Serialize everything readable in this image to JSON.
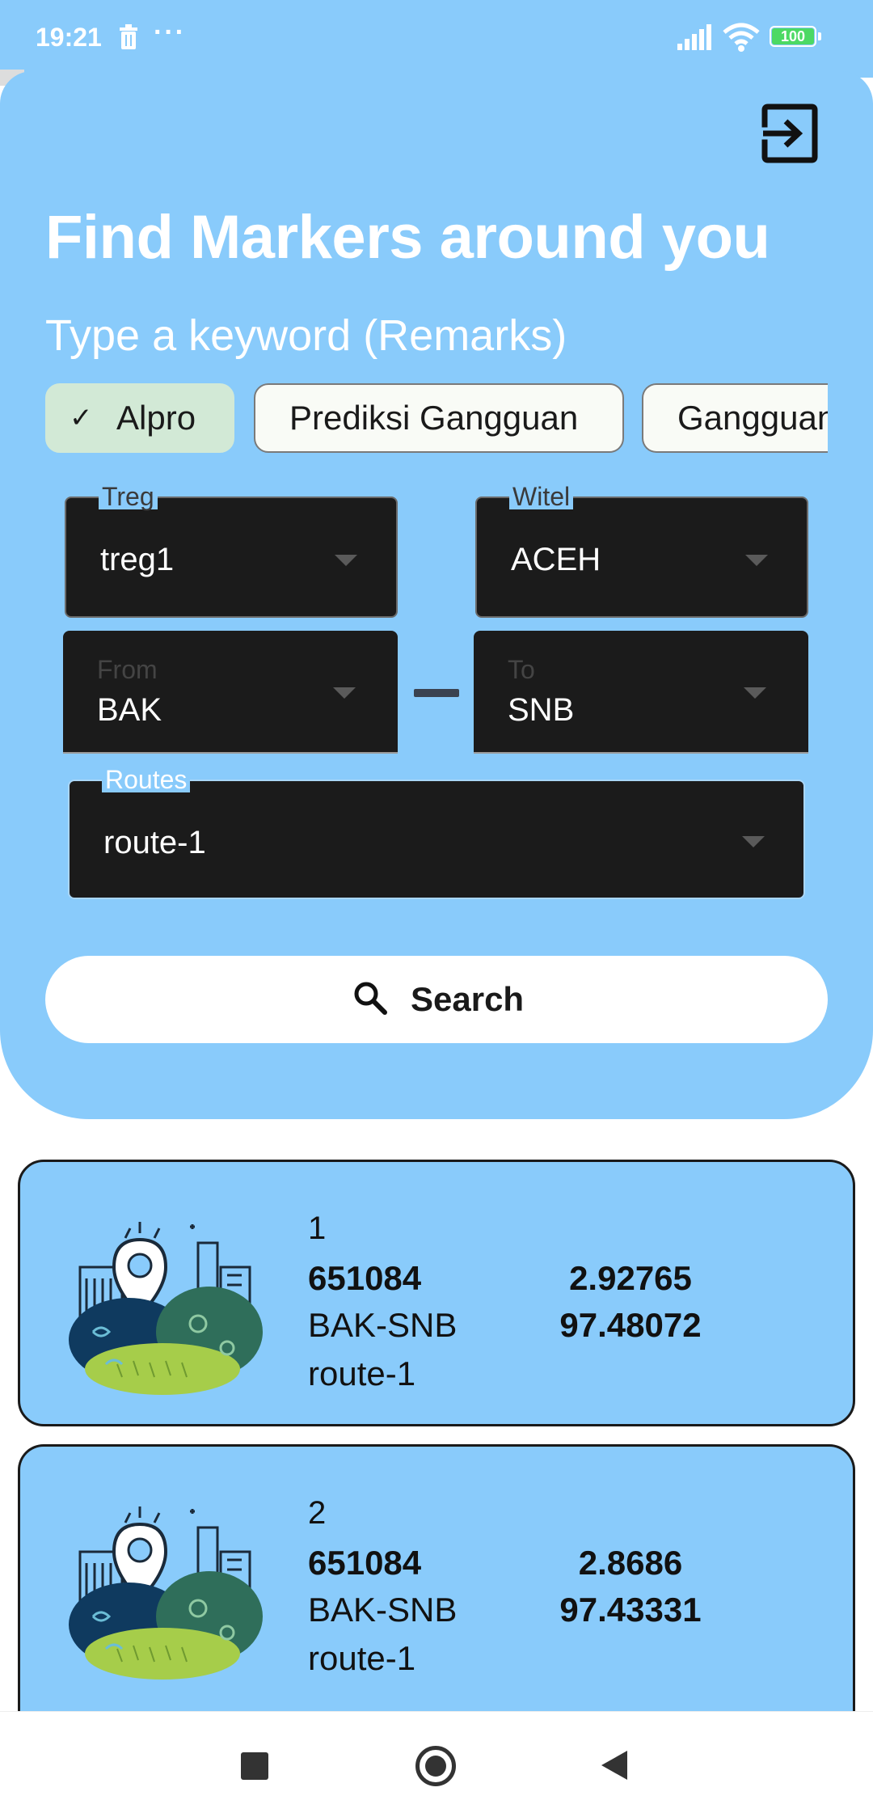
{
  "status_bar": {
    "time": "19:21",
    "more": "···",
    "battery": "100",
    "battery_color": "#4cd964"
  },
  "icons": {
    "logout": "logout-icon",
    "search": "search-icon",
    "check": "check-icon",
    "dropdown_arrow": "chevron-down-icon"
  },
  "header": {
    "title": "Find Markers around you",
    "subtitle": "Type a keyword (Remarks)",
    "background_color": "#89cbfb"
  },
  "chips": [
    {
      "label": "Alpro",
      "selected": true
    },
    {
      "label": "Prediksi Gangguan",
      "selected": false
    },
    {
      "label": "Gangguan",
      "selected": false
    }
  ],
  "filters": {
    "treg": {
      "label": "Treg",
      "value": "treg1"
    },
    "witel": {
      "label": "Witel",
      "value": "ACEH"
    },
    "from": {
      "label": "From",
      "value": "BAK"
    },
    "to": {
      "label": "To",
      "value": "SNB"
    },
    "routes": {
      "label": "Routes",
      "value": "route-1"
    }
  },
  "search": {
    "label": "Search"
  },
  "results": [
    {
      "index": "1",
      "id": "651084",
      "segment": "BAK-SNB",
      "route": "route-1",
      "lat": "2.92765",
      "lng": "97.48072"
    },
    {
      "index": "2",
      "id": "651084",
      "segment": "BAK-SNB",
      "route": "route-1",
      "lat": "2.8686",
      "lng": "97.43331"
    }
  ],
  "nav": {
    "recent": "recent-apps-button",
    "home": "home-button",
    "back": "back-button"
  }
}
